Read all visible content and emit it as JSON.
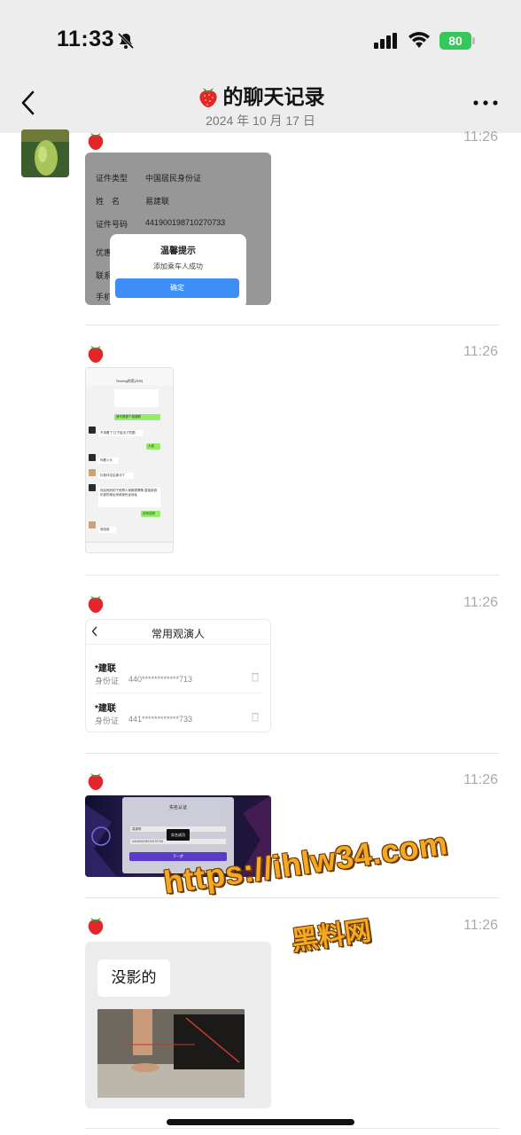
{
  "status_bar": {
    "time": "11:33",
    "battery": "80"
  },
  "header": {
    "title": "的聊天记录",
    "date": "2024 年 10 月 17 日"
  },
  "messages": [
    {
      "time": "11:26",
      "form": {
        "rows": [
          {
            "label": "证件类型",
            "value": "中国居民身份证"
          },
          {
            "label": "姓　名",
            "value": "易建联"
          },
          {
            "label": "证件号码",
            "value": "441900198710270733"
          },
          {
            "label": "优惠",
            "value": ""
          },
          {
            "label": "联系",
            "value": ""
          },
          {
            "label": "手机",
            "value": ""
          }
        ],
        "dialog_title": "温馨提示",
        "dialog_message": "添加乘车人成功",
        "dialog_button": "确定"
      }
    },
    {
      "time": "11:26",
      "screenshot": {
        "title": "Tendog的家(309)",
        "bubbles": [
          "我不是那个易建联",
          "不用看了 辽宁给出了的图",
          "大佬",
          "你着人头",
          "抖音评论区被冲了",
          "然后他妈的干他哥人家都很尊敬 直接用俱乐部的地址来填身份证地址",
          "没来这呢",
          "哈哈哈"
        ]
      }
    },
    {
      "time": "11:26",
      "card": {
        "title": "常用观演人",
        "people": [
          {
            "name": "*建联",
            "id_label": "身份证",
            "id_value": "440************713"
          },
          {
            "name": "*建联",
            "id_label": "身份证",
            "id_value": "441************733"
          }
        ]
      }
    },
    {
      "time": "11:26",
      "verify": {
        "title": "实名认证",
        "name_field": "易建联",
        "id_field": "441900198710270733",
        "toast": "实名成功",
        "button": "下一步"
      }
    },
    {
      "time": "11:26",
      "bubble": "没影的"
    }
  ],
  "watermark": {
    "line1": "https://ihlw34.com",
    "line2": "黑料网"
  },
  "colors": {
    "nav_bg": "#ededed",
    "confirm_blue": "#3d8ff5",
    "battery_green": "#34c759",
    "watermark": "#f5a821"
  }
}
